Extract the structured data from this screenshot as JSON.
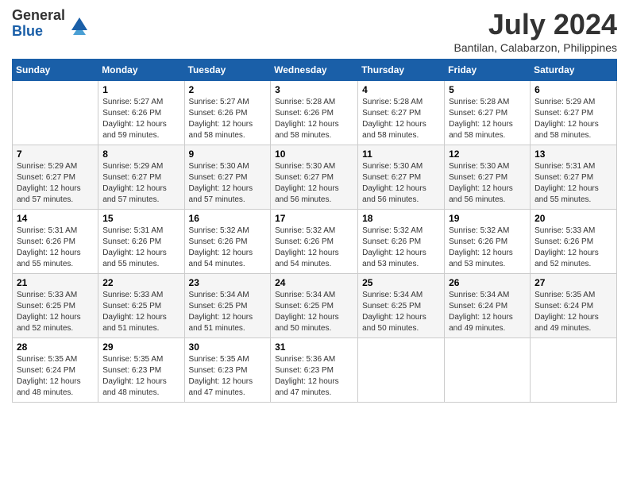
{
  "header": {
    "logo_general": "General",
    "logo_blue": "Blue",
    "month_title": "July 2024",
    "location": "Bantilan, Calabarzon, Philippines"
  },
  "calendar": {
    "days_of_week": [
      "Sunday",
      "Monday",
      "Tuesday",
      "Wednesday",
      "Thursday",
      "Friday",
      "Saturday"
    ],
    "weeks": [
      [
        {
          "day": "",
          "info": ""
        },
        {
          "day": "1",
          "info": "Sunrise: 5:27 AM\nSunset: 6:26 PM\nDaylight: 12 hours\nand 59 minutes."
        },
        {
          "day": "2",
          "info": "Sunrise: 5:27 AM\nSunset: 6:26 PM\nDaylight: 12 hours\nand 58 minutes."
        },
        {
          "day": "3",
          "info": "Sunrise: 5:28 AM\nSunset: 6:26 PM\nDaylight: 12 hours\nand 58 minutes."
        },
        {
          "day": "4",
          "info": "Sunrise: 5:28 AM\nSunset: 6:27 PM\nDaylight: 12 hours\nand 58 minutes."
        },
        {
          "day": "5",
          "info": "Sunrise: 5:28 AM\nSunset: 6:27 PM\nDaylight: 12 hours\nand 58 minutes."
        },
        {
          "day": "6",
          "info": "Sunrise: 5:29 AM\nSunset: 6:27 PM\nDaylight: 12 hours\nand 58 minutes."
        }
      ],
      [
        {
          "day": "7",
          "info": "Sunrise: 5:29 AM\nSunset: 6:27 PM\nDaylight: 12 hours\nand 57 minutes."
        },
        {
          "day": "8",
          "info": "Sunrise: 5:29 AM\nSunset: 6:27 PM\nDaylight: 12 hours\nand 57 minutes."
        },
        {
          "day": "9",
          "info": "Sunrise: 5:30 AM\nSunset: 6:27 PM\nDaylight: 12 hours\nand 57 minutes."
        },
        {
          "day": "10",
          "info": "Sunrise: 5:30 AM\nSunset: 6:27 PM\nDaylight: 12 hours\nand 56 minutes."
        },
        {
          "day": "11",
          "info": "Sunrise: 5:30 AM\nSunset: 6:27 PM\nDaylight: 12 hours\nand 56 minutes."
        },
        {
          "day": "12",
          "info": "Sunrise: 5:30 AM\nSunset: 6:27 PM\nDaylight: 12 hours\nand 56 minutes."
        },
        {
          "day": "13",
          "info": "Sunrise: 5:31 AM\nSunset: 6:27 PM\nDaylight: 12 hours\nand 55 minutes."
        }
      ],
      [
        {
          "day": "14",
          "info": "Sunrise: 5:31 AM\nSunset: 6:26 PM\nDaylight: 12 hours\nand 55 minutes."
        },
        {
          "day": "15",
          "info": "Sunrise: 5:31 AM\nSunset: 6:26 PM\nDaylight: 12 hours\nand 55 minutes."
        },
        {
          "day": "16",
          "info": "Sunrise: 5:32 AM\nSunset: 6:26 PM\nDaylight: 12 hours\nand 54 minutes."
        },
        {
          "day": "17",
          "info": "Sunrise: 5:32 AM\nSunset: 6:26 PM\nDaylight: 12 hours\nand 54 minutes."
        },
        {
          "day": "18",
          "info": "Sunrise: 5:32 AM\nSunset: 6:26 PM\nDaylight: 12 hours\nand 53 minutes."
        },
        {
          "day": "19",
          "info": "Sunrise: 5:32 AM\nSunset: 6:26 PM\nDaylight: 12 hours\nand 53 minutes."
        },
        {
          "day": "20",
          "info": "Sunrise: 5:33 AM\nSunset: 6:26 PM\nDaylight: 12 hours\nand 52 minutes."
        }
      ],
      [
        {
          "day": "21",
          "info": "Sunrise: 5:33 AM\nSunset: 6:25 PM\nDaylight: 12 hours\nand 52 minutes."
        },
        {
          "day": "22",
          "info": "Sunrise: 5:33 AM\nSunset: 6:25 PM\nDaylight: 12 hours\nand 51 minutes."
        },
        {
          "day": "23",
          "info": "Sunrise: 5:34 AM\nSunset: 6:25 PM\nDaylight: 12 hours\nand 51 minutes."
        },
        {
          "day": "24",
          "info": "Sunrise: 5:34 AM\nSunset: 6:25 PM\nDaylight: 12 hours\nand 50 minutes."
        },
        {
          "day": "25",
          "info": "Sunrise: 5:34 AM\nSunset: 6:25 PM\nDaylight: 12 hours\nand 50 minutes."
        },
        {
          "day": "26",
          "info": "Sunrise: 5:34 AM\nSunset: 6:24 PM\nDaylight: 12 hours\nand 49 minutes."
        },
        {
          "day": "27",
          "info": "Sunrise: 5:35 AM\nSunset: 6:24 PM\nDaylight: 12 hours\nand 49 minutes."
        }
      ],
      [
        {
          "day": "28",
          "info": "Sunrise: 5:35 AM\nSunset: 6:24 PM\nDaylight: 12 hours\nand 48 minutes."
        },
        {
          "day": "29",
          "info": "Sunrise: 5:35 AM\nSunset: 6:23 PM\nDaylight: 12 hours\nand 48 minutes."
        },
        {
          "day": "30",
          "info": "Sunrise: 5:35 AM\nSunset: 6:23 PM\nDaylight: 12 hours\nand 47 minutes."
        },
        {
          "day": "31",
          "info": "Sunrise: 5:36 AM\nSunset: 6:23 PM\nDaylight: 12 hours\nand 47 minutes."
        },
        {
          "day": "",
          "info": ""
        },
        {
          "day": "",
          "info": ""
        },
        {
          "day": "",
          "info": ""
        }
      ]
    ]
  }
}
